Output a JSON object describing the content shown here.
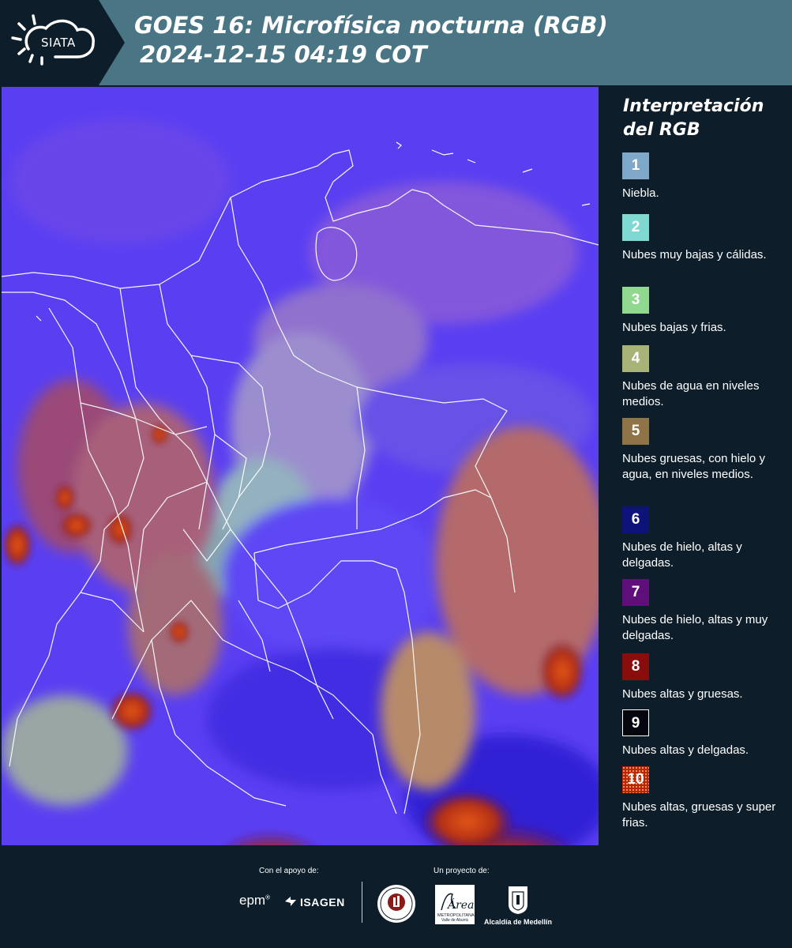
{
  "header": {
    "logo_text": "SIATA",
    "title_line1": "GOES 16: Microfísica nocturna (RGB)",
    "title_line2": "2024-12-15 04:19 COT"
  },
  "legend": {
    "title_line1": "Interpretación",
    "title_line2": "del RGB",
    "items": [
      {
        "number": "1",
        "color": "#7ea7c8",
        "label": "Niebla."
      },
      {
        "number": "2",
        "color": "#7fd8d1",
        "label": "Nubes muy bajas y cálidas."
      },
      {
        "number": "3",
        "color": "#90d890",
        "label": "Nubes bajas y frias."
      },
      {
        "number": "4",
        "color": "#a8b477",
        "label": "Nubes de agua en niveles medios."
      },
      {
        "number": "5",
        "color": "#8f7448",
        "label": "Nubes gruesas, con hielo y agua, en niveles medios."
      },
      {
        "number": "6",
        "color": "#0e137a",
        "label": "Nubes de hielo, altas y delgadas."
      },
      {
        "number": "7",
        "color": "#5e0f7a",
        "label": "Nubes de hielo, altas y muy delgadas."
      },
      {
        "number": "8",
        "color": "#8a0d0d",
        "label": "Nubes altas y gruesas."
      },
      {
        "number": "9",
        "color": "#05050f",
        "label": "Nubes altas y delgadas."
      },
      {
        "number": "10",
        "color": "#b8240e",
        "label": "Nubes altas, gruesas y super frias."
      }
    ]
  },
  "footer": {
    "support_label": "Con el apoyo de:",
    "project_label": "Un proyecto de:",
    "epm_logo": "epm",
    "isagen_logo": "ISAGEN",
    "area_logo_main": "Área",
    "area_logo_sub1": "METROPOLITANA",
    "area_logo_sub2": "Valle de Aburrá",
    "alcaldia_logo": "Alcaldía de Medellín"
  }
}
